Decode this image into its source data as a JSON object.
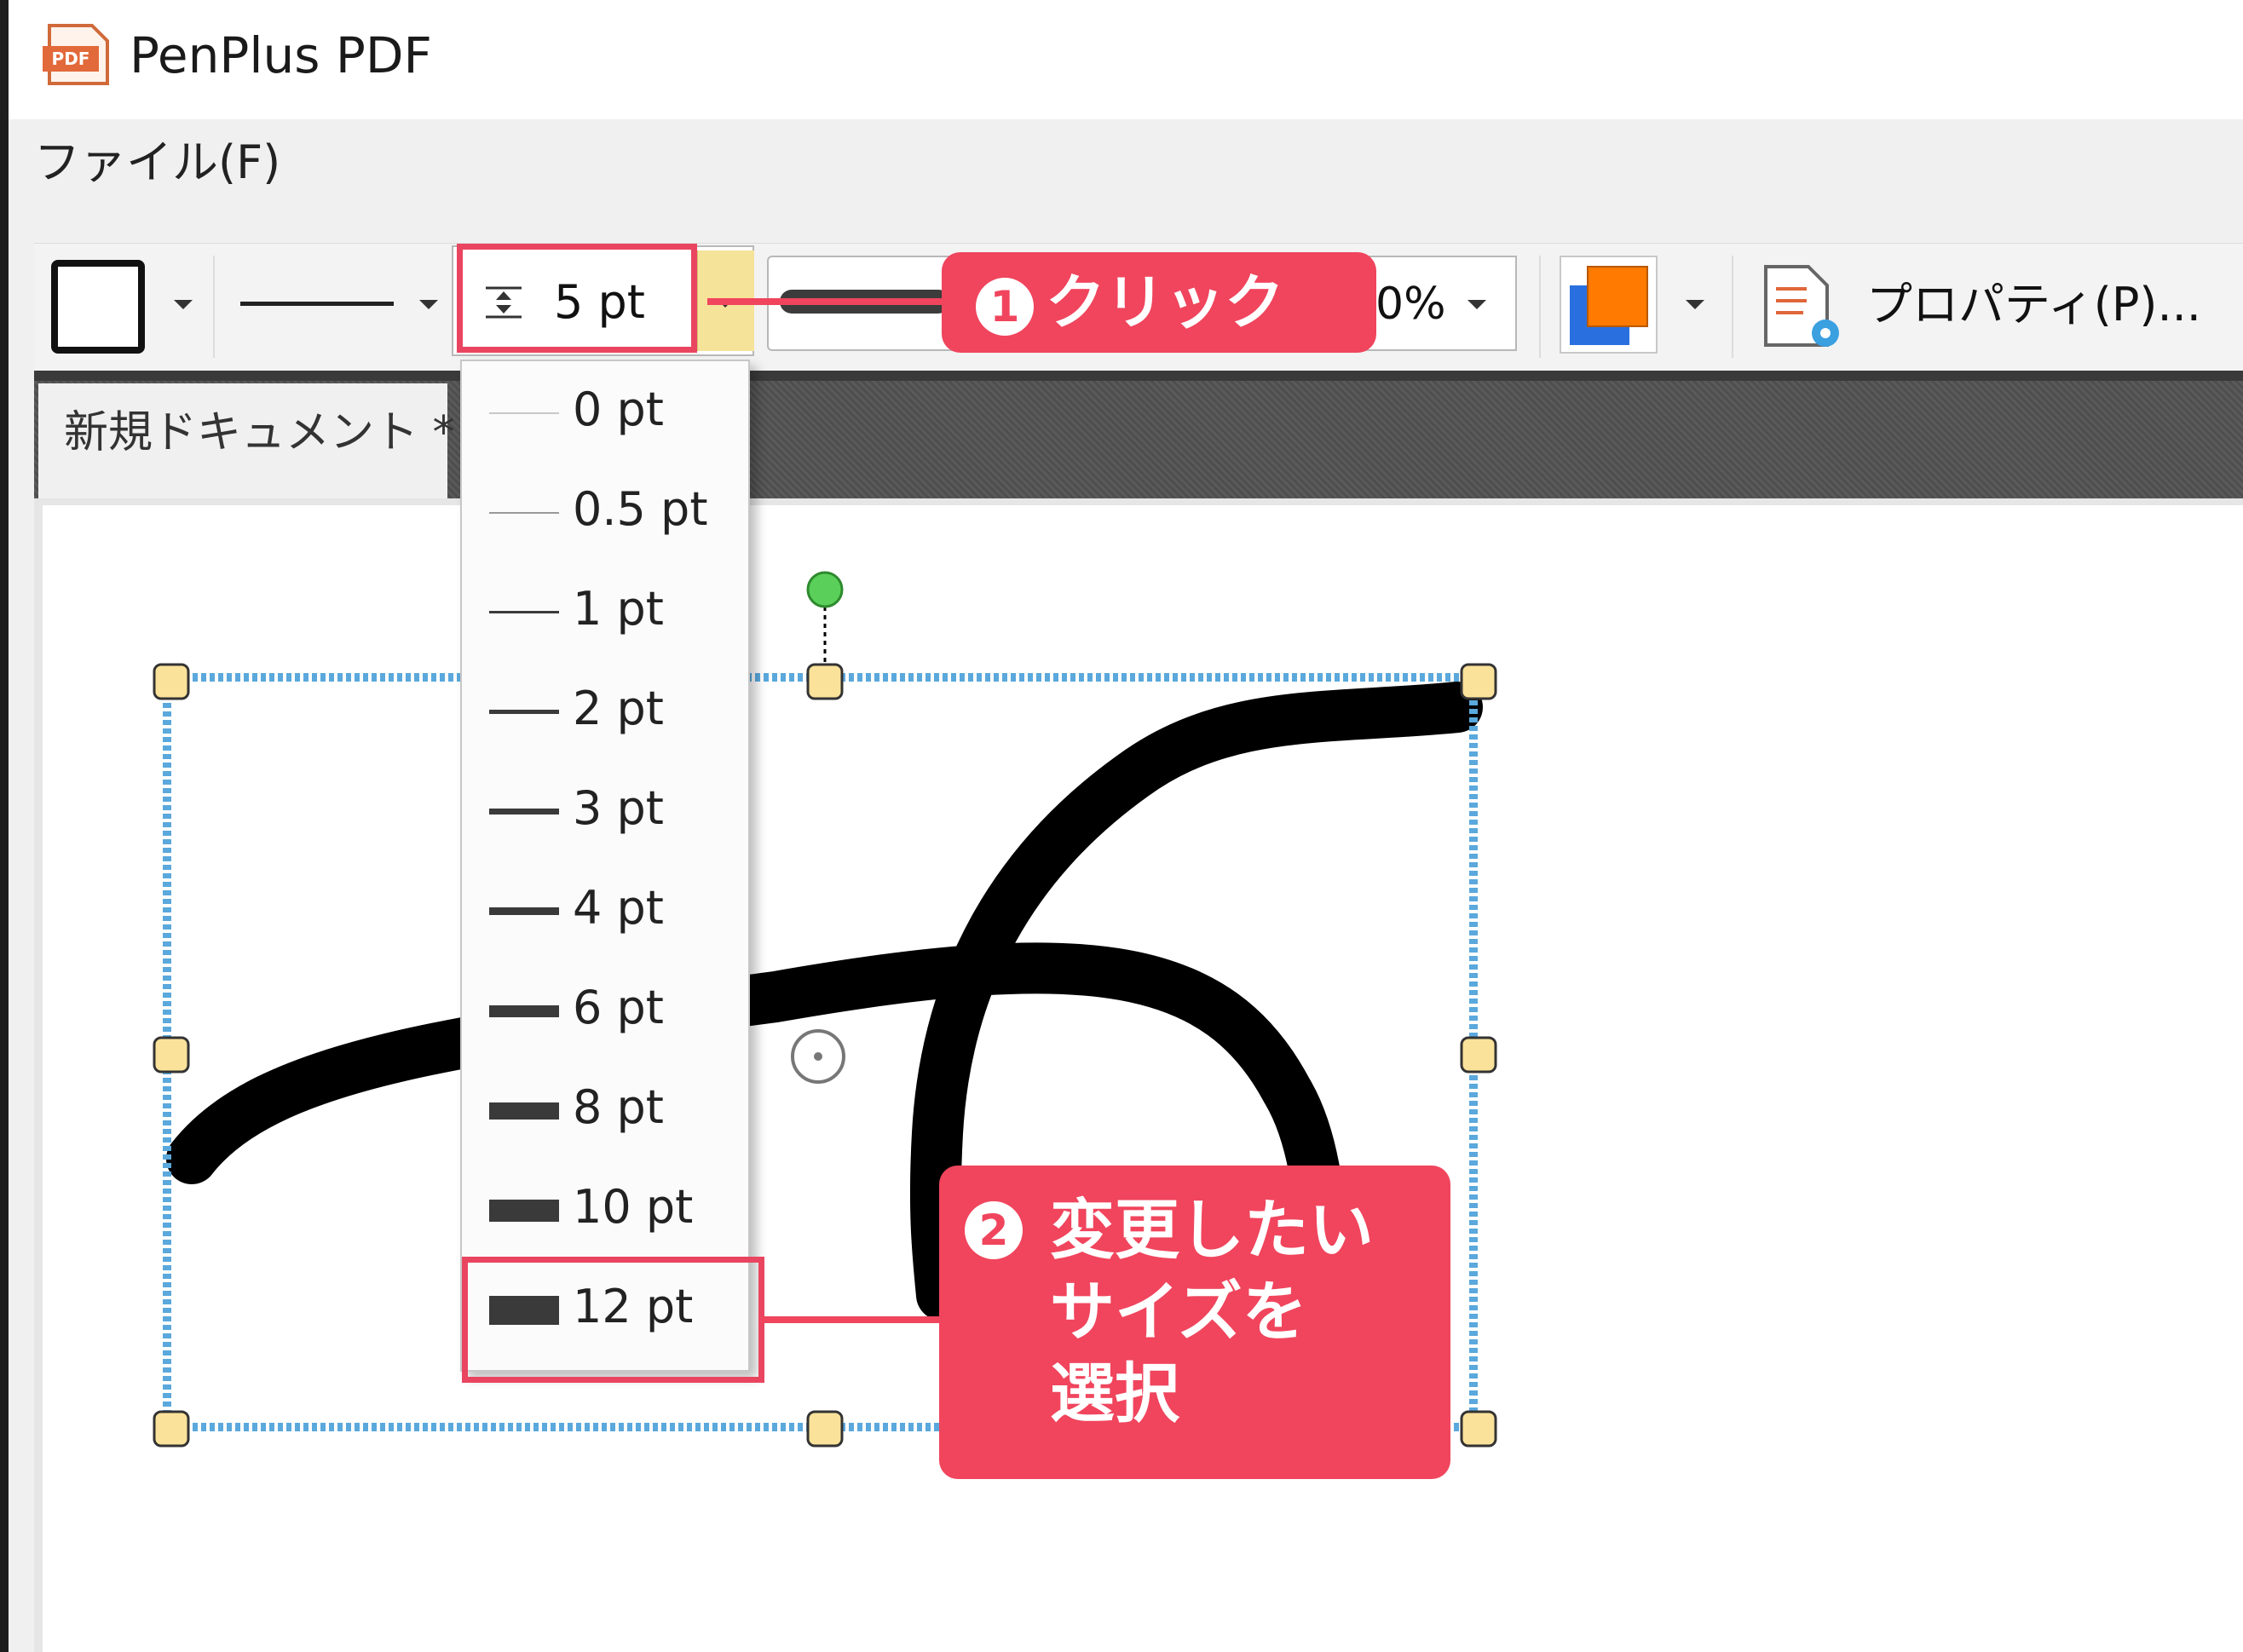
{
  "app": {
    "title": "PenPlus PDF",
    "icon_name": "pdf-app-icon"
  },
  "menu": {
    "file": "ファイル(F)"
  },
  "toolbar": {
    "width_value": "5 pt",
    "opacity_value": "0%",
    "properties_label": "プロパティ(P)...",
    "fill_color": "#ff7a00",
    "stroke_color": "#2a6fe0"
  },
  "tab": {
    "label": "新規ドキュメント *"
  },
  "width_options": [
    "0 pt",
    "0.5 pt",
    "1 pt",
    "2 pt",
    "3 pt",
    "4 pt",
    "6 pt",
    "8 pt",
    "10 pt",
    "12 pt"
  ],
  "callouts": {
    "step1_num": "1",
    "step1_text": "クリック",
    "step2_num": "2",
    "step2_line1": "変更したい",
    "step2_line2": "サイズを",
    "step2_line3": "選択"
  },
  "accent_color": "#f0455d"
}
